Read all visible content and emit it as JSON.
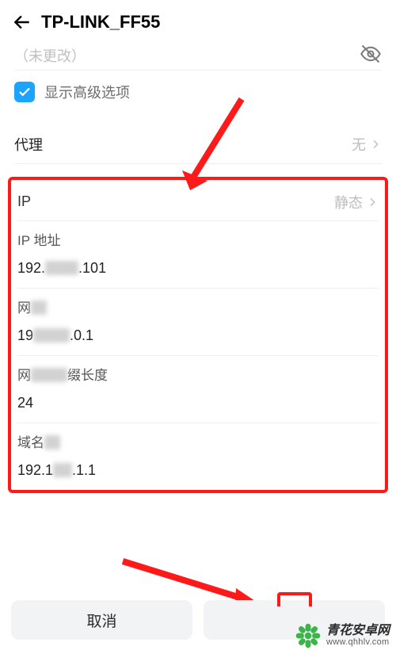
{
  "header": {
    "title": "TP-LINK_FF55"
  },
  "previous_value": "（未更改）",
  "advanced": {
    "label": "显示高级选项",
    "checked": true
  },
  "proxy": {
    "label": "代理",
    "value": "无"
  },
  "ip": {
    "protocol_label": "IP",
    "protocol_value": "静态",
    "address_label": "IP 地址",
    "address_value_a": "192.",
    "address_value_b": ".101",
    "gateway_label_a": "网",
    "gateway_value_a": "19",
    "gateway_value_b": ".0.1",
    "prefix_label_a": "网",
    "prefix_label_b": "缀长度",
    "prefix_value": "24",
    "dns_label_a": "域名",
    "dns_value_a": "192.1",
    "dns_value_b": ".1.1"
  },
  "buttons": {
    "cancel": "取消",
    "confirm": ""
  },
  "watermark": {
    "cn": "青花安卓网",
    "url": "www.qhhlv.com"
  }
}
